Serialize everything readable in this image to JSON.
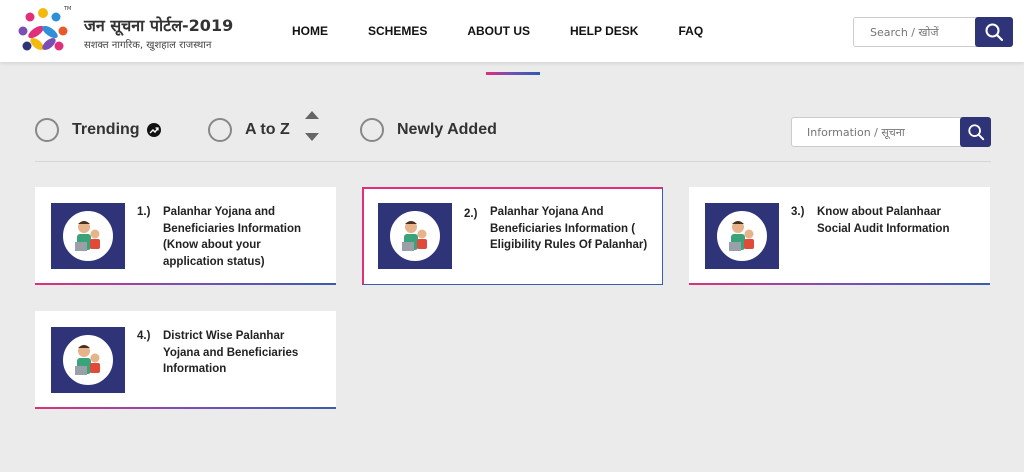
{
  "header": {
    "title": "जन सूचना पोर्टल-2019",
    "subtitle": "सशक्त नागरिक, खुशहाल राजस्थान",
    "nav": [
      "HOME",
      "SCHEMES",
      "ABOUT US",
      "HELP DESK",
      "FAQ"
    ],
    "search_placeholder": "Search / खोजें"
  },
  "filters": {
    "trending": "Trending",
    "atoz": "A to Z",
    "newly_added": "Newly Added",
    "search_placeholder": "Information / सूचना"
  },
  "cards": [
    {
      "num": "1.)",
      "title": "Palanhar Yojana and Beneficiaries Information (Know about your application status)"
    },
    {
      "num": "2.)",
      "title": "Palanhar Yojana And Beneficiaries Information ( Eligibility Rules Of Palanhar)"
    },
    {
      "num": "3.)",
      "title": "Know about Palanhaar Social Audit Information"
    },
    {
      "num": "4.)",
      "title": "District Wise Palanhar Yojana and Beneficiaries Information"
    }
  ],
  "colors": {
    "primary": "#2f3478",
    "accent_pink": "#e0307a",
    "accent_blue": "#3a5cb0"
  },
  "icons": {
    "search": "search-icon",
    "trending": "trending-icon",
    "sort": "sort-arrows-icon"
  }
}
